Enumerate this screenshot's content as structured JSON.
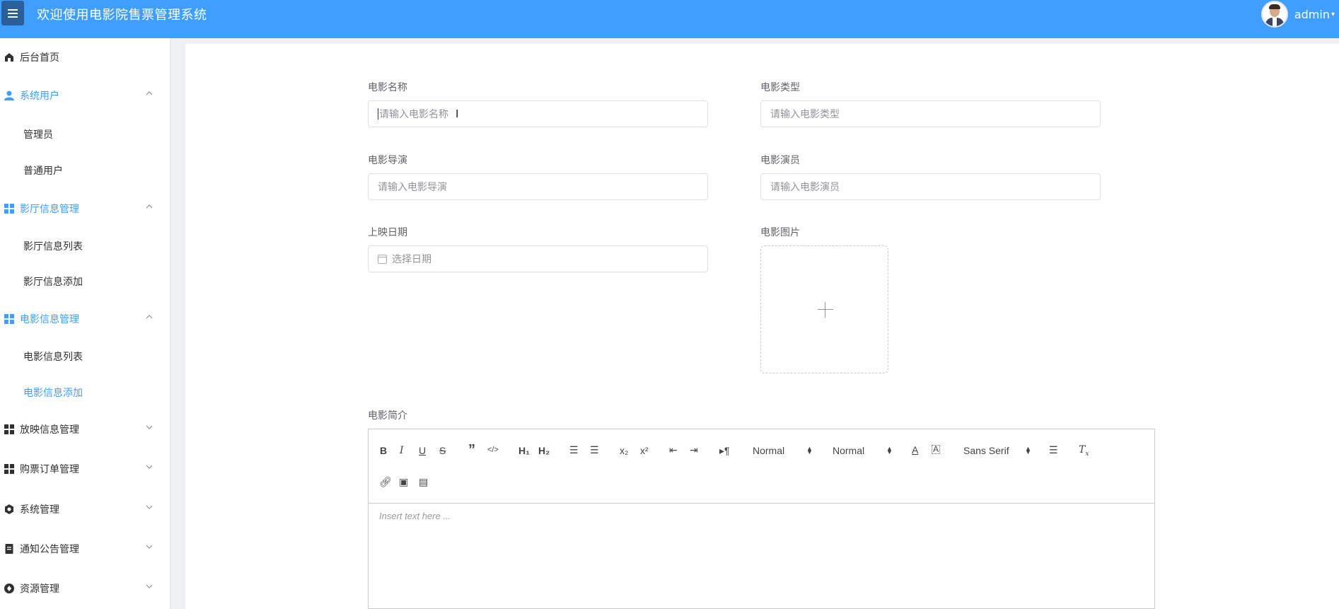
{
  "header": {
    "title": "欢迎使用电影院售票管理系统",
    "user_name": "admin",
    "caret": "▾"
  },
  "sidebar": {
    "items": [
      {
        "label": "后台首页",
        "icon": "home-icon"
      },
      {
        "label": "系统用户",
        "icon": "user-icon",
        "expanded": true
      },
      {
        "label": "管理员"
      },
      {
        "label": "普通用户"
      },
      {
        "label": "影厅信息管理",
        "icon": "grid-icon",
        "expanded": true
      },
      {
        "label": "影厅信息列表"
      },
      {
        "label": "影厅信息添加"
      },
      {
        "label": "电影信息管理",
        "icon": "grid-icon",
        "expanded": true
      },
      {
        "label": "电影信息列表"
      },
      {
        "label": "电影信息添加",
        "active": true
      },
      {
        "label": "放映信息管理",
        "icon": "grid-icon"
      },
      {
        "label": "购票订单管理",
        "icon": "grid-icon"
      },
      {
        "label": "系统管理",
        "icon": "gear-icon"
      },
      {
        "label": "通知公告管理",
        "icon": "document-icon"
      },
      {
        "label": "资源管理",
        "icon": "resource-icon"
      }
    ]
  },
  "form": {
    "name_label": "电影名称",
    "name_placeholder": "请输入电影名称",
    "type_label": "电影类型",
    "type_placeholder": "请输入电影类型",
    "director_label": "电影导演",
    "director_placeholder": "请输入电影导演",
    "actors_label": "电影演员",
    "actors_placeholder": "请输入电影演员",
    "date_label": "上映日期",
    "date_placeholder": "选择日期",
    "image_label": "电影图片",
    "intro_label": "电影简介"
  },
  "editor": {
    "header_picker": "Normal",
    "size_picker": "Normal",
    "font_picker": "Sans Serif",
    "placeholder": "Insert text here ..."
  },
  "colors": {
    "header_bg": "#409eff",
    "accent": "#409eff",
    "toggle_bg": "#2b5f9a"
  }
}
